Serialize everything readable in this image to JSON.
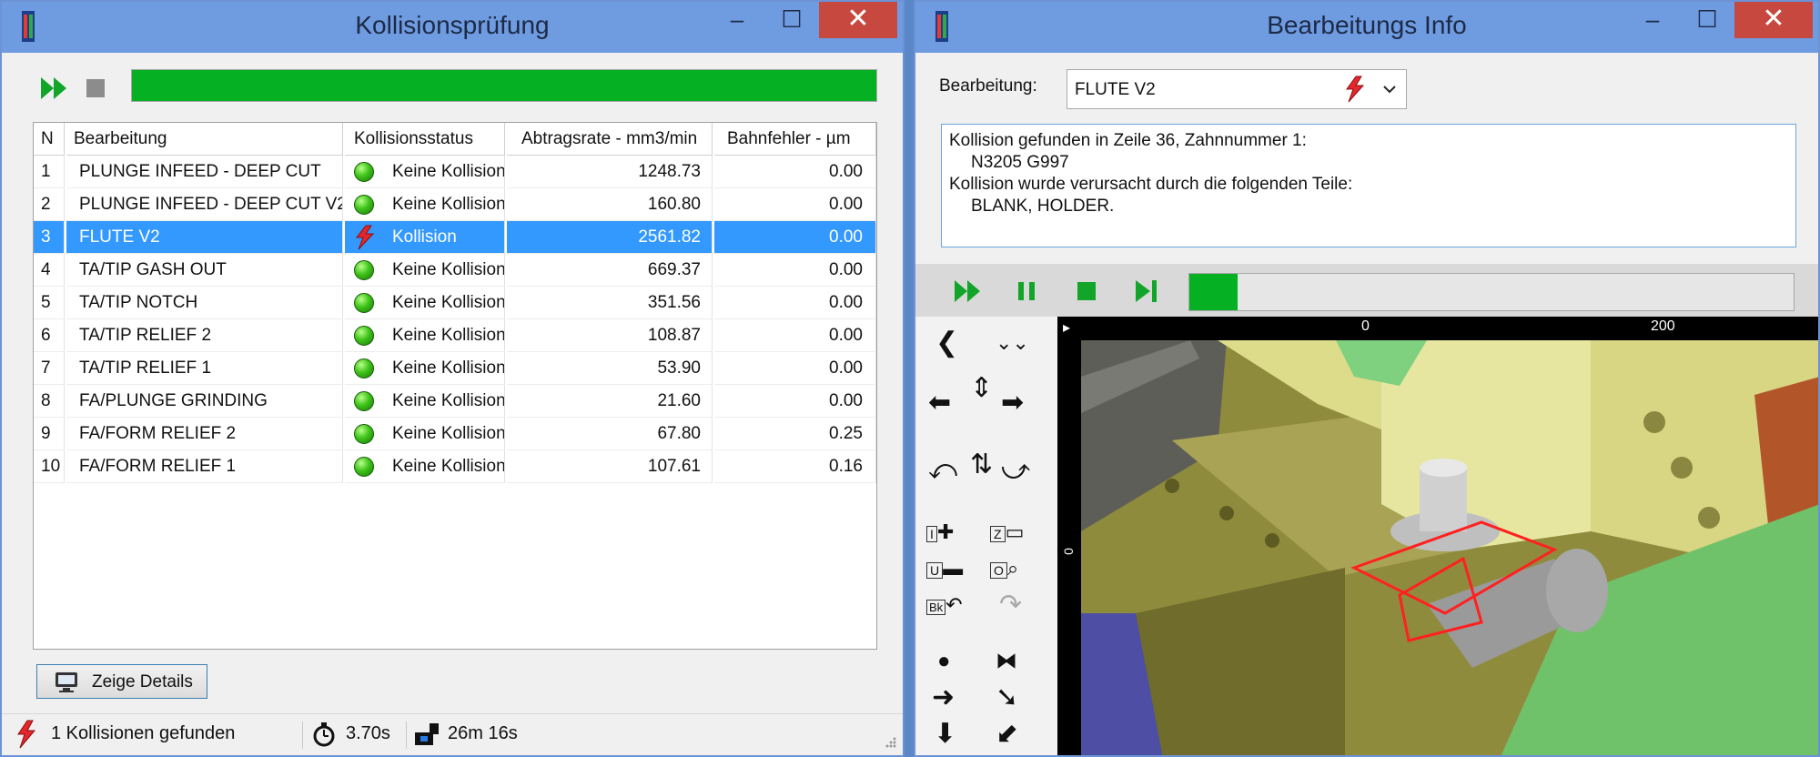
{
  "collision_window": {
    "title": "Kollisionsprüfung",
    "progress_value": 1.0,
    "columns": [
      "N",
      "Bearbeitung",
      "Kollisionsstatus",
      "Abtragsrate - mm3/min",
      "Bahnfehler - µm"
    ],
    "rows": [
      {
        "n": "1",
        "name": "PLUNGE INFEED - DEEP CUT",
        "status": "Keine Kollision",
        "rate": "1248.73",
        "error": "0.00"
      },
      {
        "n": "2",
        "name": "PLUNGE INFEED - DEEP CUT V2",
        "status": "Keine Kollision",
        "rate": "160.80",
        "error": "0.00"
      },
      {
        "n": "3",
        "name": "FLUTE V2",
        "status": "Kollision",
        "rate": "2561.82",
        "error": "0.00"
      },
      {
        "n": "4",
        "name": "TA/TIP GASH OUT",
        "status": "Keine Kollision",
        "rate": "669.37",
        "error": "0.00"
      },
      {
        "n": "5",
        "name": "TA/TIP NOTCH",
        "status": "Keine Kollision",
        "rate": "351.56",
        "error": "0.00"
      },
      {
        "n": "6",
        "name": "TA/TIP RELIEF 2",
        "status": "Keine Kollision",
        "rate": "108.87",
        "error": "0.00"
      },
      {
        "n": "7",
        "name": "TA/TIP RELIEF 1",
        "status": "Keine Kollision",
        "rate": "53.90",
        "error": "0.00"
      },
      {
        "n": "8",
        "name": "FA/PLUNGE GRINDING",
        "status": "Keine Kollision",
        "rate": "21.60",
        "error": "0.00"
      },
      {
        "n": "9",
        "name": "FA/FORM RELIEF 2",
        "status": "Keine Kollision",
        "rate": "67.80",
        "error": "0.25"
      },
      {
        "n": "10",
        "name": "FA/FORM RELIEF 1",
        "status": "Keine Kollision",
        "rate": "107.61",
        "error": "0.16"
      }
    ],
    "details_button": "Zeige Details",
    "status_collisions": "1 Kollisionen gefunden",
    "status_time": "3.70s",
    "status_duration": "26m 16s"
  },
  "info_window": {
    "title": "Bearbeitungs Info",
    "operation_label": "Bearbeitung:",
    "operation_value": "FLUTE V2",
    "message_lines": [
      "Kollision gefunden in Zeile 36, Zahnnummer 1:",
      "N3205 G997",
      "Kollision wurde verursacht durch die folgenden Teile:",
      "BLANK, HOLDER."
    ],
    "sim_progress": 0.08,
    "ruler_ticks": [
      "0",
      "200"
    ],
    "ruler_left_label": "0",
    "side_key_labels": [
      "I",
      "Z",
      "U",
      "O",
      "Bk"
    ]
  },
  "colors": {
    "titlebar": "#6f9be0",
    "progress": "#06b023",
    "selection": "#3399ff",
    "close": "#c7483f"
  }
}
